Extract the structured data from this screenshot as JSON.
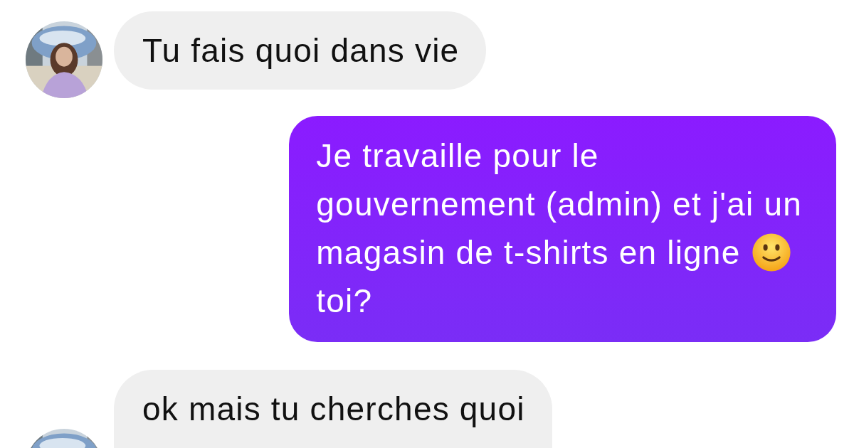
{
  "messages": [
    {
      "outgoing": false,
      "lines": [
        {
          "text": "Tu fais quoi dans vie"
        }
      ]
    },
    {
      "outgoing": true,
      "lines": [
        {
          "text": "Je travaille pour le"
        },
        {
          "text": "gouvernement (admin) et j'ai un"
        },
        {
          "text": "magasin de t-shirts en ligne",
          "smiley": true
        },
        {
          "text": "toi?"
        }
      ]
    },
    {
      "outgoing": false,
      "lines": [
        {
          "text": "ok mais tu cherches quoi"
        }
      ]
    }
  ]
}
